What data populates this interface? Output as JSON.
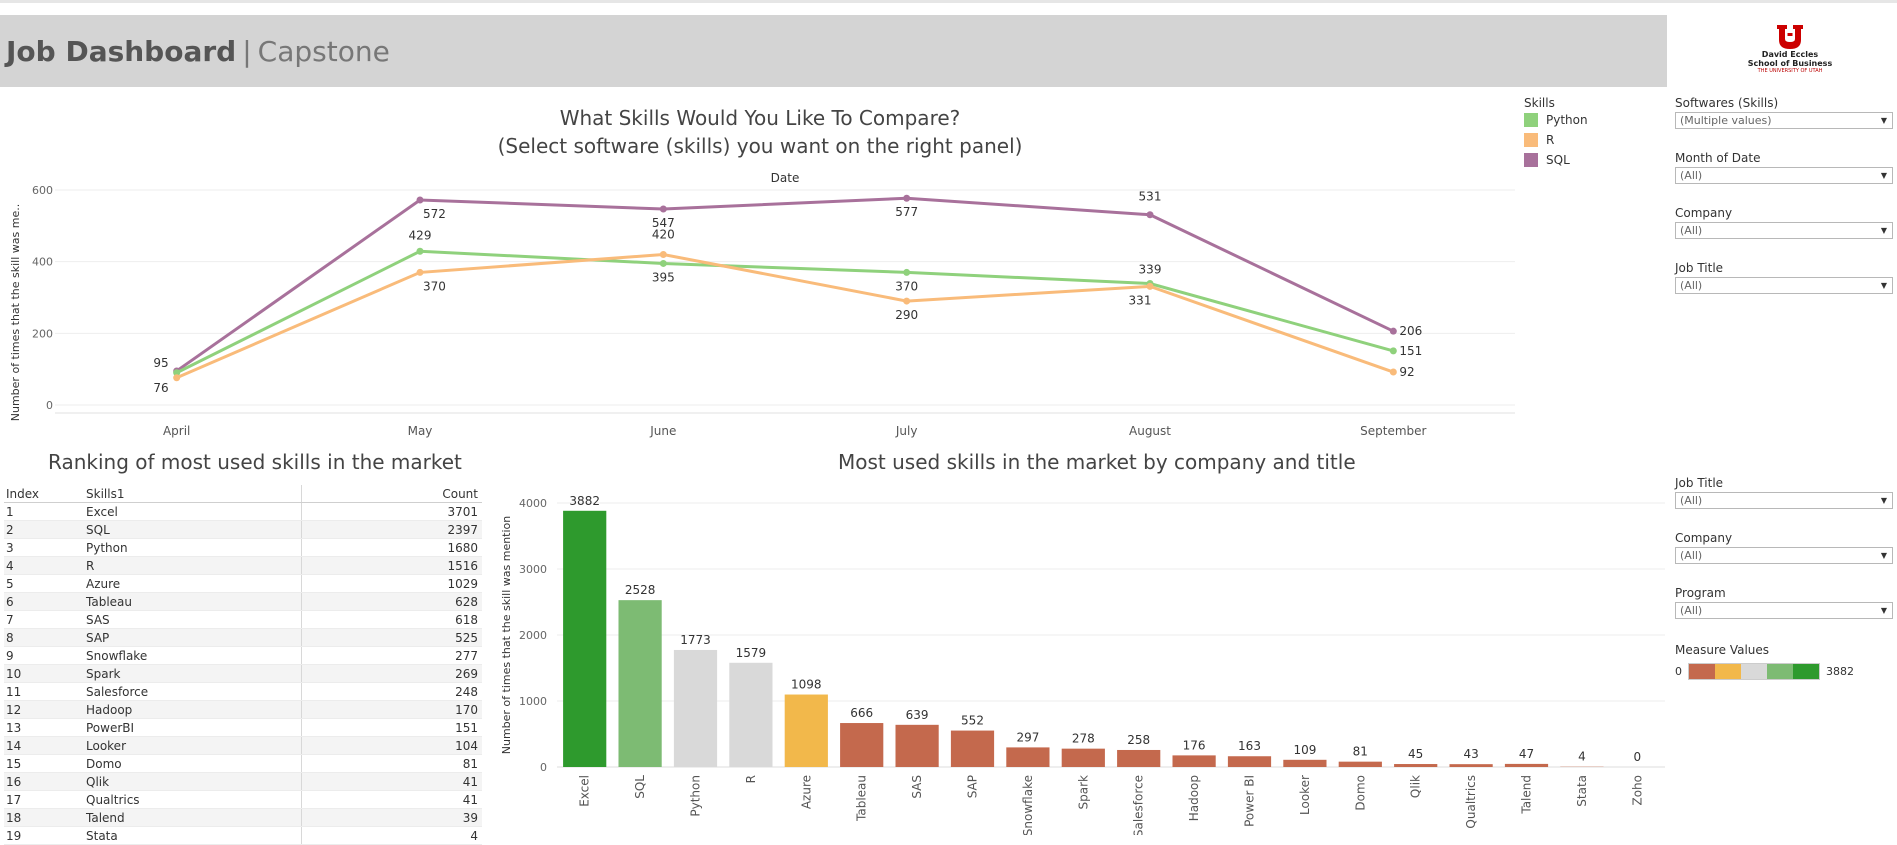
{
  "header": {
    "title_bold": "Job Dashboard",
    "separator": "|",
    "title_sub": "Capstone"
  },
  "logo": {
    "line1": "David Eccles",
    "line2": "School of Business",
    "line3": "THE UNIVERSITY OF UTAH",
    "icon": "university-u-logo-icon",
    "color": "#cc0000"
  },
  "top_chart": {
    "title_line1": "What Skills Would You Like To Compare?",
    "title_line2": "(Select software (skills) you want on the right panel)"
  },
  "legend": {
    "title": "Skills",
    "items": [
      {
        "label": "Python",
        "color": "#8fd17c"
      },
      {
        "label": "R",
        "color": "#f9bb7a"
      },
      {
        "label": "SQL",
        "color": "#a8719b"
      }
    ]
  },
  "filters_top": [
    {
      "label": "Softwares (Skills)",
      "value": "(Multiple values)"
    },
    {
      "label": "Month of Date",
      "value": "(All)"
    },
    {
      "label": "Company",
      "value": "(All)"
    },
    {
      "label": "Job Title",
      "value": "(All)"
    }
  ],
  "filters_bottom": [
    {
      "label": "Job Title",
      "value": "(All)"
    },
    {
      "label": "Company",
      "value": "(All)"
    },
    {
      "label": "Program",
      "value": "(All)"
    }
  ],
  "measure_values": {
    "label": "Measure Values",
    "min": "0",
    "max": "3882",
    "colors": [
      "#c4694d",
      "#f2b84b",
      "#d9d9d9",
      "#7dbb73",
      "#2e9a2d"
    ]
  },
  "ranking": {
    "title": "Ranking of most used skills in the market",
    "headers": [
      "Index",
      "Skills1",
      "Count"
    ],
    "rows": [
      [
        "1",
        "Excel",
        "3701"
      ],
      [
        "2",
        "SQL",
        "2397"
      ],
      [
        "3",
        "Python",
        "1680"
      ],
      [
        "4",
        "R",
        "1516"
      ],
      [
        "5",
        "Azure",
        "1029"
      ],
      [
        "6",
        "Tableau",
        "628"
      ],
      [
        "7",
        "SAS",
        "618"
      ],
      [
        "8",
        "SAP",
        "525"
      ],
      [
        "9",
        "Snowflake",
        "277"
      ],
      [
        "10",
        "Spark",
        "269"
      ],
      [
        "11",
        "Salesforce",
        "248"
      ],
      [
        "12",
        "Hadoop",
        "170"
      ],
      [
        "13",
        "PowerBI",
        "151"
      ],
      [
        "14",
        "Looker",
        "104"
      ],
      [
        "15",
        "Domo",
        "81"
      ],
      [
        "16",
        "Qlik",
        "41"
      ],
      [
        "17",
        "Qualtrics",
        "41"
      ],
      [
        "18",
        "Talend",
        "39"
      ],
      [
        "19",
        "Stata",
        "4"
      ]
    ]
  },
  "bar_section": {
    "title": "Most used skills in the market by company and title"
  },
  "chart_data": [
    {
      "type": "line",
      "title": "",
      "xlabel": "Date",
      "ylabel": "Number of times that the skill was me..",
      "categories": [
        "April",
        "May",
        "June",
        "July",
        "August",
        "September"
      ],
      "ylim": [
        0,
        600
      ],
      "yticks": [
        0,
        200,
        400,
        600
      ],
      "series": [
        {
          "name": "SQL",
          "color": "#a8719b",
          "values": [
            95,
            572,
            547,
            577,
            531,
            206
          ],
          "labels": [
            "95",
            "572",
            "547",
            "577",
            "531",
            "206"
          ]
        },
        {
          "name": "Python",
          "color": "#8fd17c",
          "values": [
            90,
            429,
            395,
            370,
            339,
            151
          ],
          "labels": [
            "",
            "429",
            "395",
            "370",
            "339",
            "151"
          ]
        },
        {
          "name": "R",
          "color": "#f9bb7a",
          "values": [
            76,
            370,
            420,
            290,
            331,
            92
          ],
          "labels": [
            "76",
            "370",
            "420",
            "290",
            "331",
            "92"
          ]
        }
      ],
      "grid": true
    },
    {
      "type": "bar",
      "title": "Most used skills in the market by company and title",
      "xlabel": "",
      "ylabel": "Number of times that the skill was mention",
      "ylim": [
        0,
        4000
      ],
      "yticks": [
        0,
        1000,
        2000,
        3000,
        4000
      ],
      "categories": [
        "Excel",
        "SQL",
        "Python",
        "R",
        "Azure",
        "Tableau",
        "SAS",
        "SAP",
        "Snowflake",
        "Spark",
        "Salesforce",
        "Hadoop",
        "Power BI",
        "Looker",
        "Domo",
        "Qlik",
        "Qualtrics",
        "Talend",
        "Stata",
        "Zoho"
      ],
      "values": [
        3882,
        2528,
        1773,
        1579,
        1098,
        666,
        639,
        552,
        297,
        278,
        258,
        176,
        163,
        109,
        81,
        45,
        43,
        47,
        4,
        0
      ],
      "colors": [
        "#2e9a2d",
        "#7dbb73",
        "#d9d9d9",
        "#d9d9d9",
        "#f2b84b",
        "#c4694d",
        "#c4694d",
        "#c4694d",
        "#c4694d",
        "#c4694d",
        "#c4694d",
        "#c4694d",
        "#c4694d",
        "#c4694d",
        "#c4694d",
        "#c4694d",
        "#c4694d",
        "#c4694d",
        "#c4694d",
        "#c4694d"
      ],
      "grid": true
    }
  ]
}
